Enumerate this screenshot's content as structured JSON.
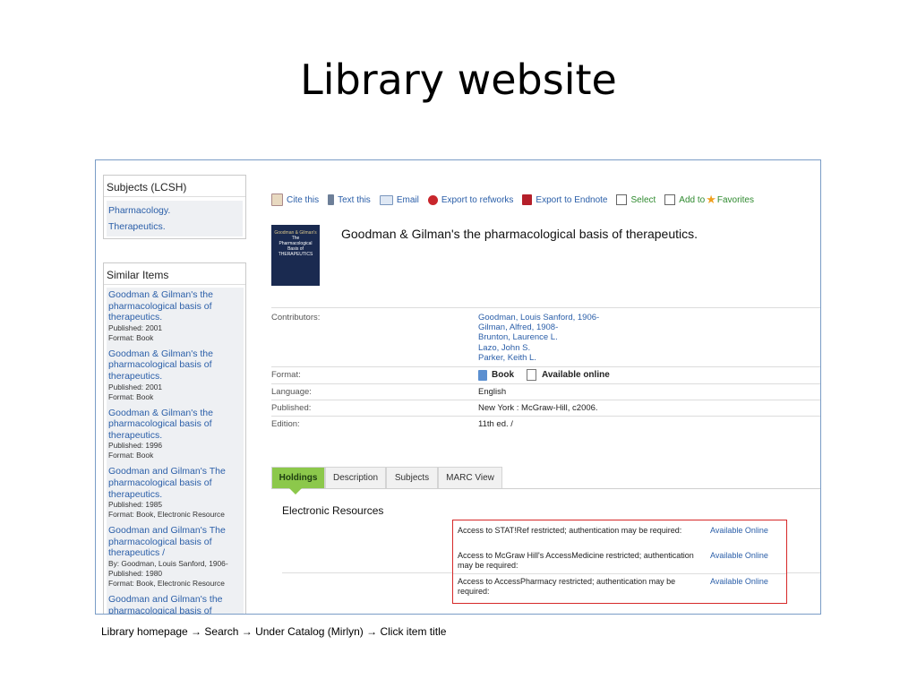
{
  "slide": {
    "title": "Library website",
    "caption": "Library homepage → Search → Under Catalog (Mirlyn) → Click item title"
  },
  "subjects": {
    "heading": "Subjects (LCSH)",
    "items": [
      "Pharmacology.",
      "Therapeutics."
    ]
  },
  "similar": {
    "heading": "Similar Items",
    "items": [
      {
        "title": "Goodman & Gilman's the pharmacological basis of therapeutics.",
        "meta": [
          "Published: 2001",
          "Format: Book"
        ]
      },
      {
        "title": "Goodman & Gilman's the pharmacological basis of therapeutics.",
        "meta": [
          "Published: 2001",
          "Format: Book"
        ]
      },
      {
        "title": "Goodman & Gilman's the pharmacological basis of therapeutics.",
        "meta": [
          "Published: 1996",
          "Format: Book"
        ]
      },
      {
        "title": "Goodman and Gilman's The pharmacological basis of therapeutics.",
        "meta": [
          "Published: 1985",
          "Format: Book, Electronic Resource"
        ]
      },
      {
        "title": "Goodman and Gilman's The pharmacological basis of therapeutics /",
        "meta": [
          "By: Goodman, Louis Sanford, 1906-",
          "Published: 1980",
          "Format: Book, Electronic Resource"
        ]
      },
      {
        "title": "Goodman and Gilman's the pharmacological basis of",
        "meta": []
      }
    ]
  },
  "toolbar": {
    "cite": "Cite this",
    "text": "Text this",
    "email": "Email",
    "refworks": "Export to refworks",
    "endnote": "Export to Endnote",
    "select": "Select",
    "add_to": "Add to",
    "favorites": "Favorites"
  },
  "record": {
    "title": "Goodman & Gilman's the pharmacological basis of therapeutics.",
    "cover_text": [
      "Goodman & Gilman's",
      "The",
      "Pharmacological",
      "Basis of",
      "THERAPEUTICS"
    ],
    "contributors_label": "Contributors:",
    "contributors": [
      "Goodman, Louis Sanford, 1906-",
      "Gilman, Alfred, 1908-",
      "Brunton, Laurence L.",
      "Lazo, John S.",
      "Parker, Keith L."
    ],
    "format_label": "Format:",
    "format_book": "Book",
    "format_online": "Available online",
    "language_label": "Language:",
    "language": "English",
    "published_label": "Published:",
    "published": "New York : McGraw-Hill, c2006.",
    "edition_label": "Edition:",
    "edition": "11th ed. /"
  },
  "tabs": {
    "holdings": "Holdings",
    "description": "Description",
    "subjects": "Subjects",
    "marc": "MARC View"
  },
  "electronic": {
    "heading": "Electronic Resources",
    "rows": [
      {
        "text": "Access to STAT!Ref restricted; authentication may be required:",
        "link": "Available Online"
      },
      {
        "text": "Access to McGraw Hill's AccessMedicine restricted; authentication may be required:",
        "link": "Available Online"
      },
      {
        "text": "Access to AccessPharmacy restricted; authentication may be required:",
        "link": "Available Online"
      }
    ]
  },
  "colors": {
    "link": "#2a5ea8",
    "tab_active": "#8cc84b",
    "highlight_box": "#d62828"
  }
}
